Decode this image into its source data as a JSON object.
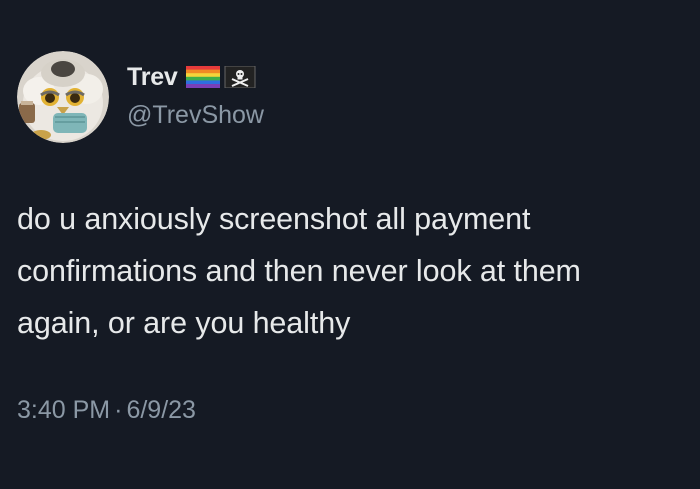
{
  "author": {
    "display_name": "Trev",
    "handle": "@TrevShow",
    "badges": [
      "rainbow-flag-icon",
      "pirate-flag-icon"
    ],
    "avatar": "avatar-icon"
  },
  "tweet": {
    "lines": [
      "do u anxiously screenshot all payment",
      "confirmations and then never look at them",
      "again, or are you healthy"
    ]
  },
  "meta": {
    "time": "3:40 PM",
    "separator": "·",
    "date": "6/9/23"
  },
  "colors": {
    "background": "#151a24",
    "primary_text": "#e7e9ea",
    "secondary_text": "#8b98a5"
  }
}
